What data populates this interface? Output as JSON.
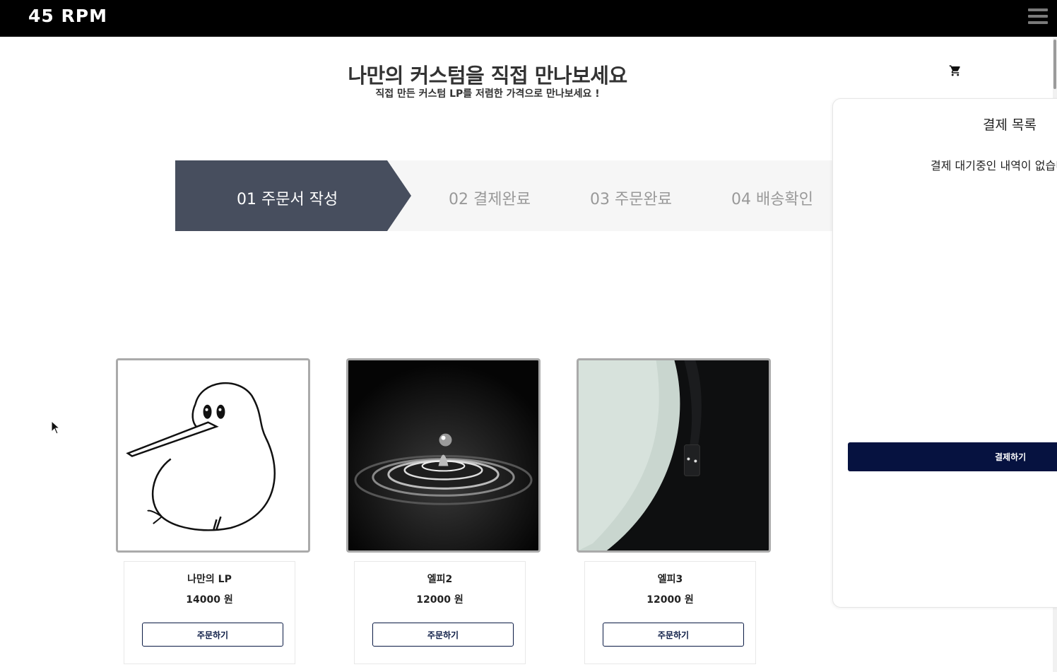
{
  "header": {
    "logo": "45 RPM",
    "menu_icon": "hamburger-menu-icon"
  },
  "hero": {
    "title": "나만의 커스텀을 직접 만나보세요",
    "subtitle": "직접 만든 커스텀 LP를 저렴한 가격으로 만나보세요 !"
  },
  "cart_icon": "shopping-cart-icon",
  "steps": [
    {
      "label": "01 주문서 작성",
      "active": true
    },
    {
      "label": "02 결제완료",
      "active": false
    },
    {
      "label": "03 주문완료",
      "active": false
    },
    {
      "label": "04 배송확인",
      "active": false
    }
  ],
  "products": [
    {
      "name": "나만의 LP",
      "price": "14000 원",
      "button": "주문하기",
      "image": "kiwi-bird-drawing"
    },
    {
      "name": "엘피2",
      "price": "12000 원",
      "button": "주문하기",
      "image": "water-drop-ripple-photo"
    },
    {
      "name": "엘피3",
      "price": "12000 원",
      "button": "주문하기",
      "image": "vinyl-record-turntable-photo"
    }
  ],
  "payment_panel": {
    "title": "결제 목록",
    "empty_message": "결제 대기중인 내역이 없습니다",
    "pay_button": "결제하기"
  },
  "colors": {
    "topbar": "#000000",
    "step_active": "#474e5e",
    "step_bg": "#f6f6f6",
    "pay_button": "#061240"
  }
}
